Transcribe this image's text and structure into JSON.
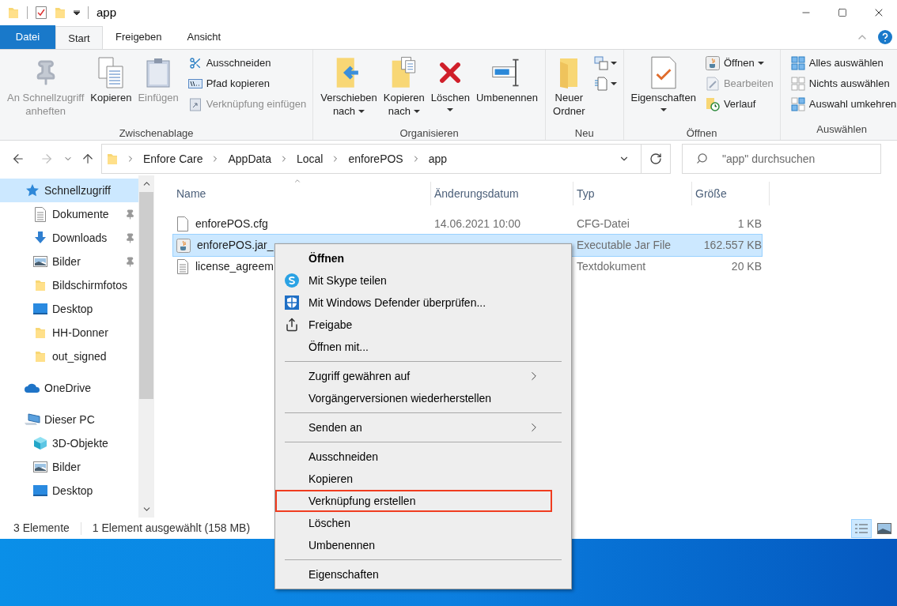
{
  "title_bar": {
    "title": "app"
  },
  "tabs": [
    {
      "label": "Datei",
      "kind": "file_menu",
      "selected": false
    },
    {
      "label": "Start",
      "kind": "tab",
      "selected": true
    },
    {
      "label": "Freigeben",
      "kind": "tab",
      "selected": false
    },
    {
      "label": "Ansicht",
      "kind": "tab",
      "selected": false
    }
  ],
  "ribbon": {
    "groups": [
      {
        "label": "Zwischenablage",
        "items": [
          {
            "kind": "large",
            "label": [
              "An Schnellzugriff",
              "anheften"
            ],
            "disabled": true,
            "dropdown": false
          },
          {
            "kind": "large",
            "label": [
              "Kopieren"
            ],
            "disabled": false,
            "dropdown": false
          },
          {
            "kind": "large",
            "label": [
              "Einfügen"
            ],
            "disabled": true,
            "dropdown": false
          },
          {
            "kind": "small",
            "label": [
              "Ausschneiden"
            ],
            "disabled": false,
            "dropdown": false
          },
          {
            "kind": "small",
            "label": [
              "Pfad kopieren"
            ],
            "disabled": false,
            "dropdown": false
          },
          {
            "kind": "small",
            "label": [
              "Verknüpfung einfügen"
            ],
            "disabled": true,
            "dropdown": false
          }
        ]
      },
      {
        "label": "Organisieren",
        "items": [
          {
            "kind": "large",
            "label": [
              "Verschieben",
              "nach"
            ],
            "disabled": false,
            "dropdown": true
          },
          {
            "kind": "large",
            "label": [
              "Kopieren",
              "nach"
            ],
            "disabled": false,
            "dropdown": true
          },
          {
            "kind": "large",
            "label": [
              "Löschen"
            ],
            "disabled": false,
            "dropdown": true
          },
          {
            "kind": "large",
            "label": [
              "Umbenennen"
            ],
            "disabled": false,
            "dropdown": false
          }
        ]
      },
      {
        "label": "Neu",
        "items": [
          {
            "kind": "large",
            "label": [
              "Neuer",
              "Ordner"
            ],
            "disabled": false,
            "dropdown": false
          },
          {
            "kind": "small_icon",
            "disabled": false,
            "dropdown": true
          },
          {
            "kind": "small_icon",
            "disabled": false,
            "dropdown": true
          }
        ]
      },
      {
        "label": "Öffnen",
        "items": [
          {
            "kind": "large",
            "label": [
              "Eigenschaften"
            ],
            "disabled": false,
            "dropdown": true
          },
          {
            "kind": "small",
            "label": [
              "Öffnen"
            ],
            "disabled": false,
            "dropdown": true
          },
          {
            "kind": "small",
            "label": [
              "Bearbeiten"
            ],
            "disabled": true,
            "dropdown": false
          },
          {
            "kind": "small",
            "label": [
              "Verlauf"
            ],
            "disabled": false,
            "dropdown": false
          }
        ]
      },
      {
        "label": "Auswählen",
        "items": [
          {
            "kind": "small",
            "label": [
              "Alles auswählen"
            ],
            "disabled": false,
            "dropdown": false
          },
          {
            "kind": "small",
            "label": [
              "Nichts auswählen"
            ],
            "disabled": false,
            "dropdown": false
          },
          {
            "kind": "small",
            "label": [
              "Auswahl umkehren"
            ],
            "disabled": false,
            "dropdown": false
          }
        ]
      }
    ]
  },
  "address_bar": {
    "path": [
      "Enfore Care",
      "AppData",
      "Local",
      "enforePOS",
      "app"
    ]
  },
  "search": {
    "placeholder": "\"app\" durchsuchen"
  },
  "sidebar": {
    "items": [
      {
        "label": "Schnellzugriff",
        "selected": true,
        "children": [
          {
            "label": "Dokumente",
            "pinned": true,
            "selected": false
          },
          {
            "label": "Downloads",
            "pinned": true,
            "selected": false
          },
          {
            "label": "Bilder",
            "pinned": true,
            "selected": false
          },
          {
            "label": "Bildschirmfotos",
            "pinned": false,
            "selected": false
          },
          {
            "label": "Desktop",
            "pinned": false,
            "selected": false
          },
          {
            "label": "HH-Donner",
            "pinned": false,
            "selected": false
          },
          {
            "label": "out_signed",
            "pinned": false,
            "selected": false
          }
        ]
      },
      {
        "label": "OneDrive",
        "selected": false
      },
      {
        "label": "Dieser PC",
        "selected": false,
        "children": [
          {
            "label": "3D-Objekte",
            "pinned": false,
            "selected": false
          },
          {
            "label": "Bilder",
            "pinned": false,
            "selected": false
          },
          {
            "label": "Desktop",
            "pinned": false,
            "selected": false
          }
        ]
      }
    ]
  },
  "file_list": {
    "columns": [
      "Name",
      "Änderungsdatum",
      "Typ",
      "Größe"
    ],
    "rows": [
      {
        "name": "enforePOS.cfg",
        "date": "14.06.2021 10:00",
        "type": "CFG-Datei",
        "size": "1 KB",
        "selected": false
      },
      {
        "name": "enforePOS.jar_",
        "type": "Executable Jar File",
        "size": "162.557 KB",
        "selected": true
      },
      {
        "name": "license_agreem",
        "type": "Textdokument",
        "size": "20 KB",
        "selected": false
      }
    ]
  },
  "status_bar": {
    "item_count": "3 Elemente",
    "selection": "1 Element ausgewählt (158 MB)",
    "views": [
      {
        "selected": true
      },
      {
        "selected": false
      }
    ]
  },
  "context_menu": {
    "sections": [
      [
        {
          "label": "Öffnen",
          "default": true,
          "submenu": false,
          "highlighted": false
        },
        {
          "label": "Mit Skype teilen",
          "default": false,
          "submenu": false,
          "highlighted": false
        },
        {
          "label": "Mit Windows Defender überprüfen...",
          "default": false,
          "submenu": false,
          "highlighted": false
        },
        {
          "label": "Freigabe",
          "default": false,
          "submenu": false,
          "highlighted": false
        },
        {
          "label": "Öffnen mit...",
          "default": false,
          "submenu": false,
          "highlighted": false
        }
      ],
      [
        {
          "label": "Zugriff gewähren auf",
          "default": false,
          "submenu": true,
          "highlighted": false
        },
        {
          "label": "Vorgängerversionen wiederherstellen",
          "default": false,
          "submenu": false,
          "highlighted": false
        }
      ],
      [
        {
          "label": "Senden an",
          "default": false,
          "submenu": true,
          "highlighted": false
        }
      ],
      [
        {
          "label": "Ausschneiden",
          "default": false,
          "submenu": false,
          "highlighted": false
        },
        {
          "label": "Kopieren",
          "default": false,
          "submenu": false,
          "highlighted": false
        },
        {
          "label": "Verknüpfung erstellen",
          "default": false,
          "submenu": false,
          "highlighted": true
        },
        {
          "label": "Löschen",
          "default": false,
          "submenu": false,
          "highlighted": false
        },
        {
          "label": "Umbenennen",
          "default": false,
          "submenu": false,
          "highlighted": false
        }
      ],
      [
        {
          "label": "Eigenschaften",
          "default": false,
          "submenu": false,
          "highlighted": false
        }
      ]
    ]
  }
}
